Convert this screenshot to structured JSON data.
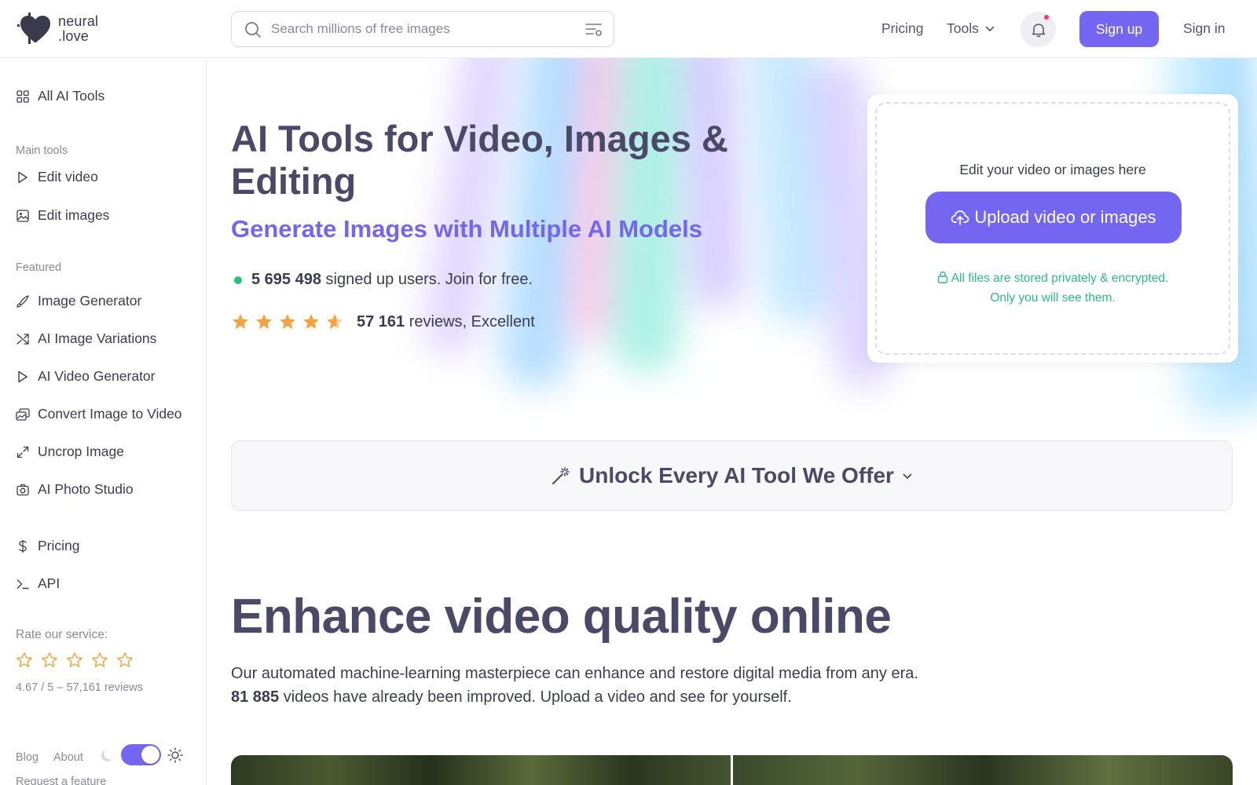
{
  "header": {
    "logo_line1": "neural",
    "logo_line2": ".love",
    "search_placeholder": "Search millions of free images",
    "nav_pricing": "Pricing",
    "nav_tools": "Tools",
    "signup": "Sign up",
    "signin": "Sign in"
  },
  "sidebar": {
    "all_tools": "All AI Tools",
    "main_heading": "Main tools",
    "main_items": [
      "Edit video",
      "Edit images"
    ],
    "featured_heading": "Featured",
    "featured_items": [
      "Image Generator",
      "AI Image Variations",
      "AI Video Generator",
      "Convert Image to Video",
      "Uncrop Image",
      "AI Photo Studio"
    ],
    "pricing": "Pricing",
    "api": "API",
    "rate_heading": "Rate our service:",
    "rate_summary": "4.67 / 5 – 57,161 reviews",
    "footer_blog": "Blog",
    "footer_about": "About",
    "footer_request": "Request a feature"
  },
  "hero": {
    "title": "AI Tools for Video, Images & Editing",
    "subtitle": "Generate Images with Multiple AI Models",
    "users_count": "5 695 498",
    "users_text": "signed up users. Join for free.",
    "reviews_count": "57 161",
    "reviews_text": "reviews, Excellent",
    "rating": 4.67
  },
  "upload": {
    "label": "Edit your video or images here",
    "button": "Upload video or images",
    "privacy_line1": "All files are stored privately & encrypted.",
    "privacy_line2": "Only you will see them."
  },
  "unlock": {
    "label": "Unlock Every AI Tool We Offer"
  },
  "enhance": {
    "title": "Enhance video quality online",
    "desc_line1": "Our automated machine-learning masterpiece can enhance and restore digital media from any era.",
    "improved_count": "81 885",
    "desc_line2": "videos have already been improved. Upload a video and see for yourself."
  },
  "colors": {
    "accent": "#7466f0",
    "text": "#4a4a68",
    "success": "#2bbc83",
    "star": "#f4a340"
  }
}
